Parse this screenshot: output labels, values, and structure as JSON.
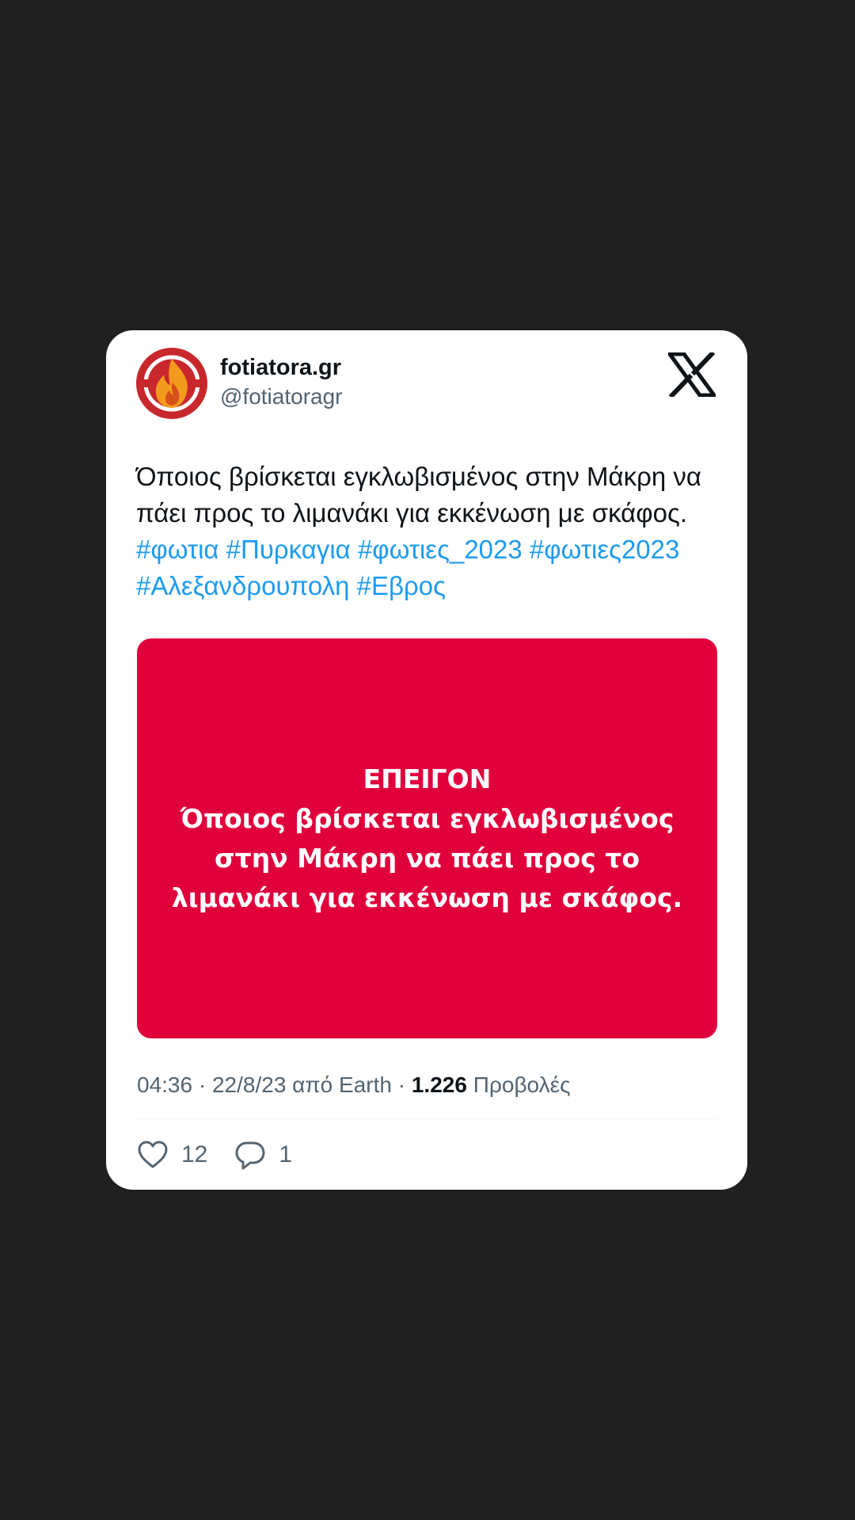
{
  "author": {
    "display_name": "fotiatora.gr",
    "handle": "@fotiatoragr"
  },
  "tweet": {
    "text": "Όποιος βρίσκεται εγκλωβισμένος στην Μάκρη να πάει προς το λιμανάκι για εκκένωση με σκάφος.",
    "hashtags": [
      "#φωτια",
      "#Πυρκαγια",
      "#φωτιες_2023",
      "#φωτιες2023",
      "#Αλεξανδρουπολη",
      "#Εβρος"
    ]
  },
  "media": {
    "lines": [
      "ΕΠΕΙΓΟΝ",
      "Όποιος βρίσκεται εγκλωβισμένος",
      "στην Μάκρη να πάει προς το",
      "λιμανάκι για εκκένωση με σκάφος."
    ]
  },
  "meta": {
    "time": "04:36",
    "separator": "·",
    "date": "22/8/23",
    "source_prefix": "από",
    "source": "Earth",
    "views_count": "1.226",
    "views_label": "Προβολές"
  },
  "actions": {
    "likes": "12",
    "replies": "1"
  },
  "icons": {
    "avatar": "fire-logo-icon",
    "platform": "x-logo-icon",
    "like": "heart-icon",
    "reply": "speech-bubble-icon"
  },
  "colors": {
    "background": "#202020",
    "card": "#ffffff",
    "hashtag": "#1d9bf0",
    "media": "#e0003c",
    "muted": "#536471",
    "text": "#0f1419"
  }
}
